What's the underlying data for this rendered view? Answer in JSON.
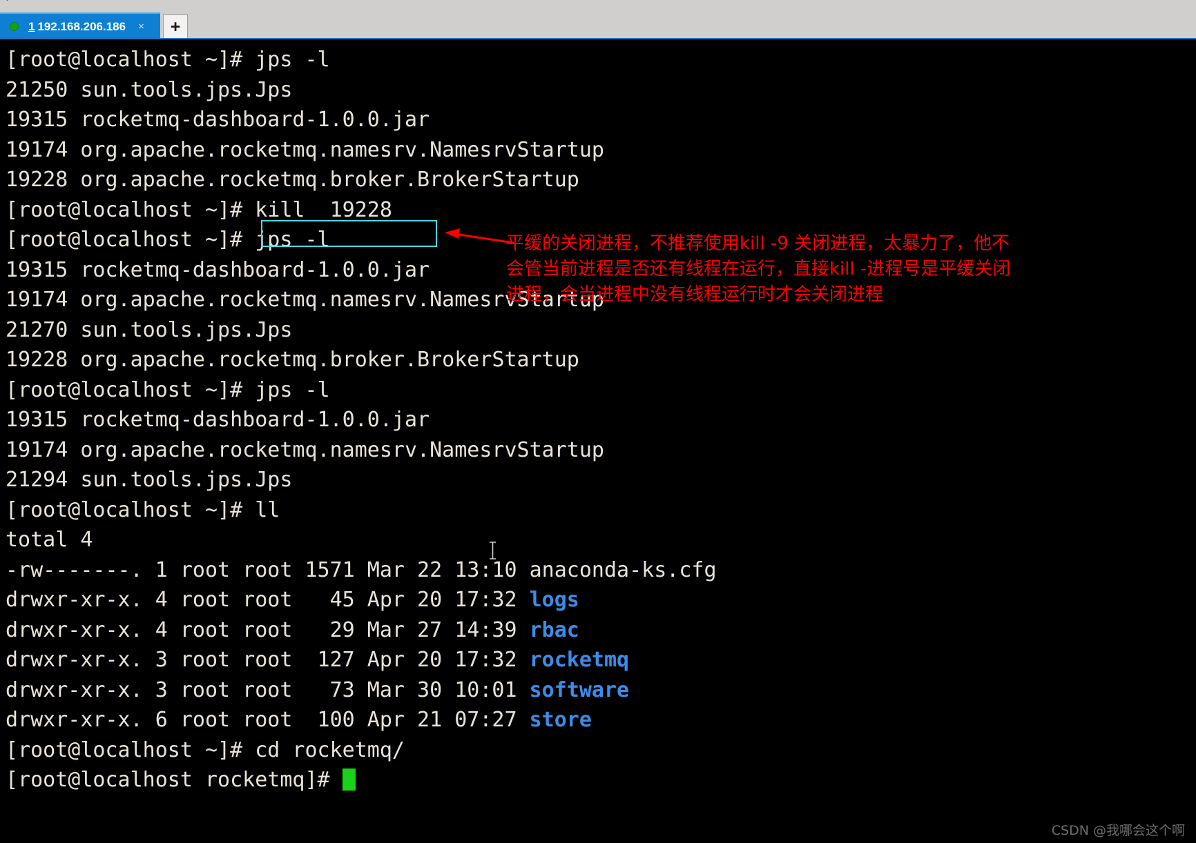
{
  "window": {
    "tab": {
      "index_label": "1",
      "title": "192.168.206.186",
      "close_label": "×",
      "status_dot_color": "#12a112",
      "active_bg_color": "#0f7fd4"
    },
    "new_tab_label": "+"
  },
  "terminal": {
    "background_color": "#000000",
    "foreground_color": "#e8e3d9",
    "directory_color": "#3c8ce8",
    "cursor_color": "#18d318",
    "lines": [
      {
        "text": "[root@localhost ~]# jps -l"
      },
      {
        "text": "21250 sun.tools.jps.Jps"
      },
      {
        "text": "19315 rocketmq-dashboard-1.0.0.jar"
      },
      {
        "text": "19174 org.apache.rocketmq.namesrv.NamesrvStartup"
      },
      {
        "text": "19228 org.apache.rocketmq.broker.BrokerStartup"
      },
      {
        "text": "[root@localhost ~]# kill  19228"
      },
      {
        "text": "[root@localhost ~]# jps -l"
      },
      {
        "text": "19315 rocketmq-dashboard-1.0.0.jar"
      },
      {
        "text": "19174 org.apache.rocketmq.namesrv.NamesrvStartup"
      },
      {
        "text": "21270 sun.tools.jps.Jps"
      },
      {
        "text": "19228 org.apache.rocketmq.broker.BrokerStartup"
      },
      {
        "text": "[root@localhost ~]# jps -l"
      },
      {
        "text": "19315 rocketmq-dashboard-1.0.0.jar"
      },
      {
        "text": "19174 org.apache.rocketmq.namesrv.NamesrvStartup"
      },
      {
        "text": "21294 sun.tools.jps.Jps"
      },
      {
        "text": "[root@localhost ~]# ll"
      },
      {
        "text": "total 4"
      },
      {
        "text": "-rw-------. 1 root root 1571 Mar 22 13:10 anaconda-ks.cfg"
      },
      {
        "prefix": "drwxr-xr-x. 4 root root   45 Apr 20 17:32 ",
        "dir": "logs"
      },
      {
        "prefix": "drwxr-xr-x. 4 root root   29 Mar 27 14:39 ",
        "dir": "rbac"
      },
      {
        "prefix": "drwxr-xr-x. 3 root root  127 Apr 20 17:32 ",
        "dir": "rocketmq"
      },
      {
        "prefix": "drwxr-xr-x. 3 root root   73 Mar 30 10:01 ",
        "dir": "software"
      },
      {
        "prefix": "drwxr-xr-x. 6 root root  100 Apr 21 07:27 ",
        "dir": "store"
      },
      {
        "text": "[root@localhost ~]# cd rocketmq/"
      },
      {
        "text": "[root@localhost rocketmq]# ",
        "cursor": true
      }
    ]
  },
  "annotation": {
    "highlight_color": "#49d9e6",
    "text_color": "#ff0000",
    "highlighted_command": "kill  19228",
    "lines": [
      "平缓的关闭进程，不推荐使用kill -9 关闭进程，太暴力了，他不",
      "会管当前进程是否还有线程在运行，直接kill -进程号是平缓关闭",
      "进程，会当进程中没有线程运行时才会关闭进程"
    ]
  },
  "watermark": {
    "text": "CSDN @我哪会这个啊"
  }
}
